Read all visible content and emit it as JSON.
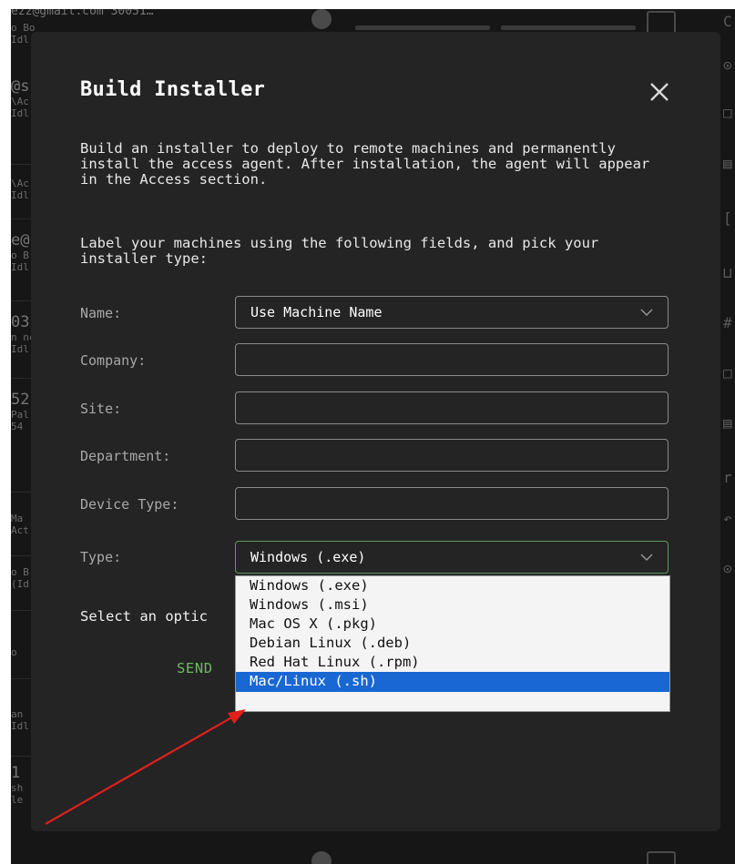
{
  "background": {
    "top_text": "ezz@gmail.com  30051…",
    "list_items": [
      {
        "lines": [
          "o Bobek",
          "Idl"
        ]
      },
      {
        "lines": [
          "@s",
          "\\Ac",
          "Idl"
        ]
      },
      {
        "lines": [
          "\\Ac",
          "Idl"
        ]
      },
      {
        "lines": [
          "e@",
          "o B",
          "Idl"
        ],
        "big": true
      },
      {
        "lines": [
          "03",
          "n nc",
          "Idl"
        ],
        "big": true
      },
      {
        "lines": [
          "52",
          "Pal",
          "54"
        ],
        "big": true
      },
      {
        "lines": [
          "Ma",
          "Act"
        ]
      },
      {
        "lines": [
          "o B",
          "(Id"
        ]
      },
      {
        "lines": [
          "o"
        ]
      },
      {
        "lines": [
          "an",
          "Idl"
        ]
      },
      {
        "lines": [
          "1",
          "sh",
          "le"
        ],
        "big": true
      }
    ]
  },
  "modal": {
    "title": "Build Installer",
    "intro": "Build an installer to deploy to remote machines and permanently install the access agent. After installation, the agent will appear in the Access section.",
    "instructions": "Label your machines using the following fields, and pick your installer type:",
    "fields": {
      "name": {
        "label": "Name:",
        "value": "Use Machine Name"
      },
      "company": {
        "label": "Company:",
        "value": ""
      },
      "site": {
        "label": "Site:",
        "value": ""
      },
      "department": {
        "label": "Department:",
        "value": ""
      },
      "device_type": {
        "label": "Device Type:",
        "value": ""
      },
      "type": {
        "label": "Type:",
        "value": "Windows (.exe)"
      }
    },
    "select_option_text": "Select an optic",
    "send_label": "SEND"
  },
  "dropdown": {
    "options": [
      "Windows (.exe)",
      "Windows (.msi)",
      "Mac OS X (.pkg)",
      "Debian Linux (.deb)",
      "Red Hat Linux (.rpm)",
      "Mac/Linux (.sh)"
    ],
    "highlighted": "Mac/Linux (.sh)"
  },
  "colors": {
    "modal_bg": "#242424",
    "send_green": "#6dbb5f",
    "highlight_blue": "#1967d2",
    "active_border": "#5e9a5e",
    "annotation_arrow": "#e0201b"
  }
}
